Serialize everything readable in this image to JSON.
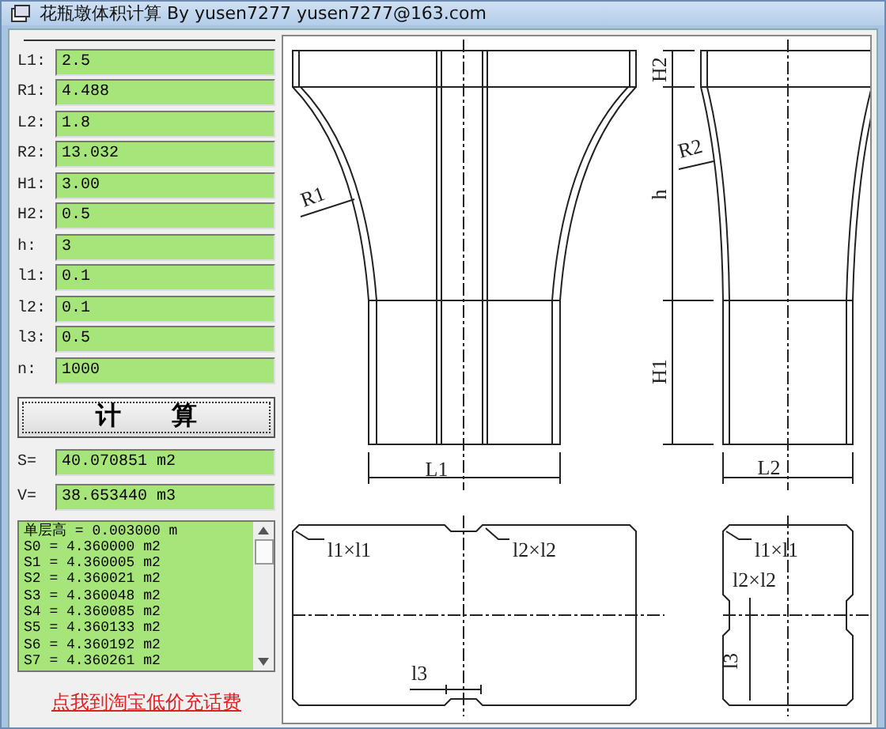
{
  "window": {
    "title": "花瓶墩体积计算 By yusen7277  yusen7277@163.com"
  },
  "inputs": [
    {
      "label": "L1:",
      "value": "2.5"
    },
    {
      "label": "R1:",
      "value": "4.488"
    },
    {
      "label": "L2:",
      "value": "1.8"
    },
    {
      "label": "R2:",
      "value": "13.032"
    },
    {
      "label": "H1:",
      "value": "3.00"
    },
    {
      "label": "H2:",
      "value": "0.5"
    },
    {
      "label": "h:",
      "value": "3"
    },
    {
      "label": "l1:",
      "value": "0.1"
    },
    {
      "label": "l2:",
      "value": "0.1"
    },
    {
      "label": "l3:",
      "value": "0.5"
    },
    {
      "label": "n:",
      "value": "1000"
    }
  ],
  "calculate_button": "计　　算",
  "results": [
    {
      "label": "S=",
      "value": "40.070851 m2"
    },
    {
      "label": "V=",
      "value": "38.653440 m3"
    }
  ],
  "output_list": [
    "单层高 = 0.003000 m",
    "S0 = 4.360000 m2",
    "S1 = 4.360005 m2",
    "S2 = 4.360021 m2",
    "S3 = 4.360048 m2",
    "S4 = 4.360085 m2",
    "S5 = 4.360133 m2",
    "S6 = 4.360192 m2",
    "S7 = 4.360261 m2"
  ],
  "link": "点我到淘宝低价充话费",
  "drawing": {
    "labels": [
      "R1",
      "L1",
      "H2",
      "h",
      "H1",
      "R2",
      "L2",
      "l1×l1",
      "l2×l2",
      "l3",
      "l1×l1",
      "l2×l2",
      "l3"
    ]
  }
}
